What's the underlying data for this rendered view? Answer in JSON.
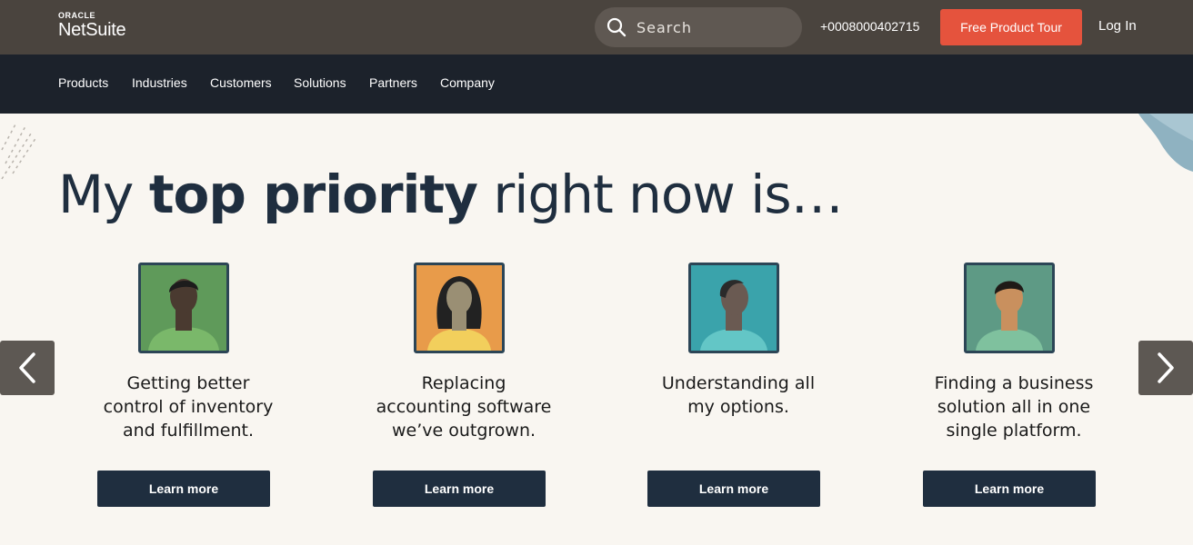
{
  "header": {
    "logo": {
      "brand_top": "ORACLE",
      "brand_main": "NetSuite"
    },
    "search": {
      "placeholder": "Search"
    },
    "phone": "+0008000402715",
    "tour_button": "Free Product Tour",
    "login": "Log In"
  },
  "nav": {
    "items": [
      "Products",
      "Industries",
      "Customers",
      "Solutions",
      "Partners",
      "Company"
    ]
  },
  "hero": {
    "title_prefix": "My ",
    "title_bold": "top priority",
    "title_suffix": " right now is…"
  },
  "cards": [
    {
      "text": "Getting better control of inventory and fulfillment.",
      "button": "Learn more",
      "portrait_bg": "#5f9a5a",
      "shirt": "#7ab86a",
      "skin": "#4a3a30",
      "hair": "#1d1c1c"
    },
    {
      "text": "Replacing accounting software we’ve outgrown.",
      "button": "Learn more",
      "portrait_bg": "#e89b4a",
      "shirt": "#f2cf5c",
      "skin": "#9a8f74",
      "hair": "#222222"
    },
    {
      "text": "Understanding all my options.",
      "button": "Learn more",
      "portrait_bg": "#3aa3ab",
      "shirt": "#63c6c6",
      "skin": "#6a5a52",
      "hair": "#2a2a2a"
    },
    {
      "text": "Finding a business solution all in one single platform.",
      "button": "Learn more",
      "portrait_bg": "#5e9a85",
      "shirt": "#7fc19e",
      "skin": "#c9905e",
      "hair": "#1f1a17"
    }
  ],
  "carousel": {
    "prev_icon": "chevron-left-icon",
    "next_icon": "chevron-right-icon"
  },
  "colors": {
    "topbar": "#4a443e",
    "navbar": "#1c222b",
    "accent": "#e5533d",
    "background": "#f9f6f1",
    "button_dark": "#1f2e3f"
  }
}
